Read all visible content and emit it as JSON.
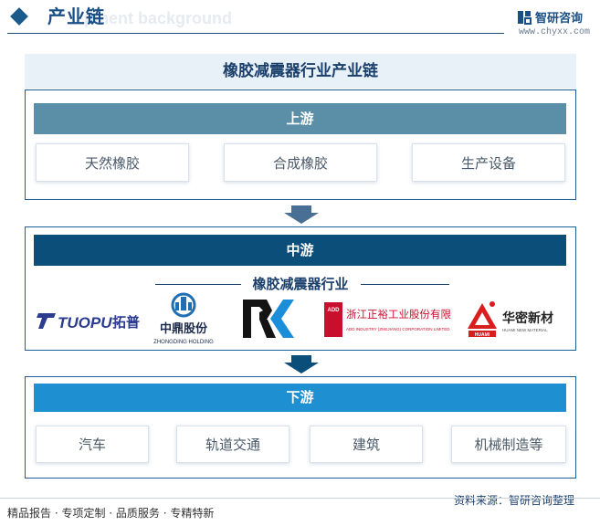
{
  "header": {
    "title": "产业链",
    "ghost_text": "pment background",
    "brand_name": "智研咨询",
    "brand_url": "www.chyxx.com"
  },
  "main_title": "橡胶减震器行业产业链",
  "upstream": {
    "label": "上游",
    "items": [
      "天然橡胶",
      "合成橡胶",
      "生产设备"
    ]
  },
  "midstream": {
    "label": "中游",
    "subtitle": "橡胶减震器行业",
    "companies": [
      {
        "name": "TUOPU",
        "cn": "拓普"
      },
      {
        "name": "中鼎股份",
        "en": "ZHONGDING HOLDING"
      },
      {
        "name": "RK"
      },
      {
        "name": "浙江正裕工业股份有限公司",
        "en": "ADD INDUSTRY (ZHEJIANG) CORPORATION LIMITED",
        "tag": "ADD"
      },
      {
        "name": "华密新材",
        "en": "HUAMI NEW MATERIAL",
        "tag": "HUAMI"
      }
    ]
  },
  "downstream": {
    "label": "下游",
    "items": [
      "汽车",
      "轨道交通",
      "建筑",
      "机械制造等"
    ]
  },
  "footer": {
    "left": "精品报告 · 专项定制 · 品质服务 · 专精特新",
    "right": "资料来源：智研咨询整理"
  },
  "colors": {
    "upstream_bar": "#5b8fa8",
    "midstream_bar": "#0b4e79",
    "downstream_bar": "#1e8fd0",
    "panel_border": "#1f5f98",
    "arrow": "#4a6f94"
  }
}
